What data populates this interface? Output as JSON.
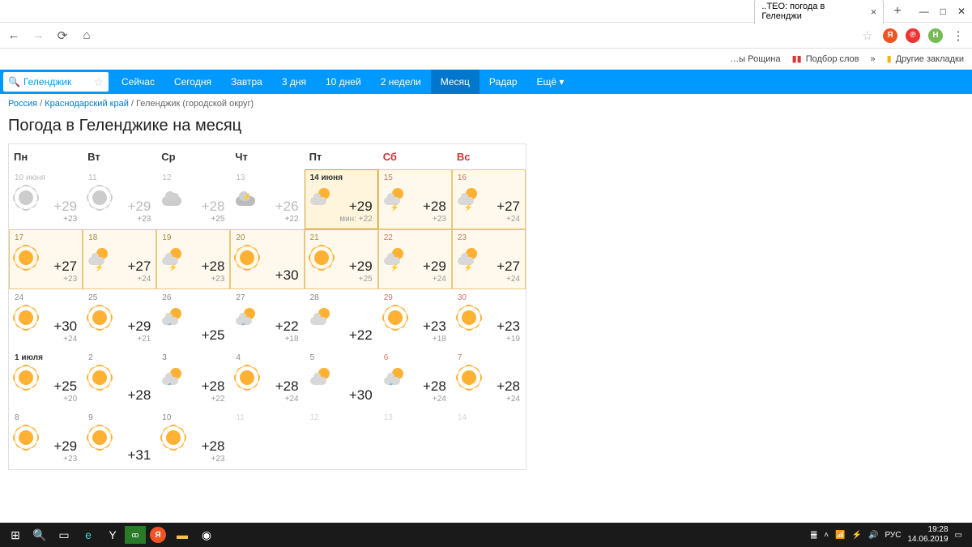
{
  "browser": {
    "tab_title": "..TEO: погода в Геленджи",
    "new_tab": "+",
    "min": "—",
    "max": "□",
    "close": "✕"
  },
  "bookmarks": {
    "b1": "…ы Рощина",
    "b2": "Подбор слов",
    "more": "»",
    "other": "Другие закладки"
  },
  "search": {
    "value": "Геленджик"
  },
  "nav": {
    "now": "Сейчас",
    "today": "Сегодня",
    "tomorrow": "Завтра",
    "d3": "3 дня",
    "d10": "10 дней",
    "w2": "2 недели",
    "month": "Месяц",
    "radar": "Радар",
    "more": "Ещё ▾"
  },
  "crumbs": {
    "c1": "Россия",
    "c2": "Краснодарский край",
    "c3": "Геленджик (городской округ)"
  },
  "title": "Погода в Геленджике на месяц",
  "days": {
    "mo": "Пн",
    "tu": "Вт",
    "we": "Ср",
    "th": "Чт",
    "fr": "Пт",
    "sa": "Сб",
    "su": "Вс"
  },
  "cells": [
    {
      "dt": "10 июня",
      "hi": "+29",
      "lo": "+23",
      "ic": "sund",
      "cls": "past"
    },
    {
      "dt": "11",
      "hi": "+29",
      "lo": "+23",
      "ic": "sund",
      "cls": "past"
    },
    {
      "dt": "12",
      "hi": "+28",
      "lo": "+25",
      "ic": "cloudd",
      "cls": "past"
    },
    {
      "dt": "13",
      "hi": "+26",
      "lo": "+22",
      "ic": "stormd",
      "cls": "past"
    },
    {
      "dt": "14 июня",
      "hi": "+29",
      "lo": "мин: +22",
      "ic": "suncloud",
      "cls": "today"
    },
    {
      "dt": "15",
      "hi": "+28",
      "lo": "+23",
      "ic": "sunstorm",
      "cls": "hl",
      "we": true
    },
    {
      "dt": "16",
      "hi": "+27",
      "lo": "+24",
      "ic": "sunstorm",
      "cls": "hl",
      "we": true
    },
    {
      "dt": "17",
      "hi": "+27",
      "lo": "+23",
      "ic": "sun",
      "cls": "hl"
    },
    {
      "dt": "18",
      "hi": "+27",
      "lo": "+24",
      "ic": "sunstorm",
      "cls": "hl"
    },
    {
      "dt": "19",
      "hi": "+28",
      "lo": "+23",
      "ic": "sunstorm",
      "cls": "hl"
    },
    {
      "dt": "20",
      "hi": "+30",
      "lo": "",
      "ic": "sun",
      "cls": "hl"
    },
    {
      "dt": "21",
      "hi": "+29",
      "lo": "+25",
      "ic": "sun",
      "cls": "hl"
    },
    {
      "dt": "22",
      "hi": "+29",
      "lo": "+24",
      "ic": "sunstorm",
      "cls": "hl",
      "we": true
    },
    {
      "dt": "23",
      "hi": "+27",
      "lo": "+24",
      "ic": "sunstorm",
      "cls": "hl",
      "we": true
    },
    {
      "dt": "24",
      "hi": "+30",
      "lo": "+24",
      "ic": "sun",
      "cls": ""
    },
    {
      "dt": "25",
      "hi": "+29",
      "lo": "+21",
      "ic": "sun",
      "cls": ""
    },
    {
      "dt": "26",
      "hi": "+25",
      "lo": "",
      "ic": "sunrain",
      "cls": ""
    },
    {
      "dt": "27",
      "hi": "+22",
      "lo": "+18",
      "ic": "sunrain",
      "cls": ""
    },
    {
      "dt": "28",
      "hi": "+22",
      "lo": "",
      "ic": "suncloud",
      "cls": ""
    },
    {
      "dt": "29",
      "hi": "+23",
      "lo": "+18",
      "ic": "sun",
      "cls": "",
      "we": true
    },
    {
      "dt": "30",
      "hi": "+23",
      "lo": "+19",
      "ic": "sun",
      "cls": "",
      "we": true
    },
    {
      "dt": "1 июля",
      "hi": "+25",
      "lo": "+20",
      "ic": "sun",
      "cls": "",
      "bold": true
    },
    {
      "dt": "2",
      "hi": "+28",
      "lo": "",
      "ic": "sun",
      "cls": ""
    },
    {
      "dt": "3",
      "hi": "+28",
      "lo": "+22",
      "ic": "sunrain",
      "cls": ""
    },
    {
      "dt": "4",
      "hi": "+28",
      "lo": "+24",
      "ic": "sun",
      "cls": ""
    },
    {
      "dt": "5",
      "hi": "+30",
      "lo": "",
      "ic": "suncloud",
      "cls": ""
    },
    {
      "dt": "6",
      "hi": "+28",
      "lo": "+24",
      "ic": "sunrain",
      "cls": "",
      "we": true
    },
    {
      "dt": "7",
      "hi": "+28",
      "lo": "+24",
      "ic": "sun",
      "cls": "",
      "we": true
    },
    {
      "dt": "8",
      "hi": "+29",
      "lo": "+23",
      "ic": "sun",
      "cls": ""
    },
    {
      "dt": "9",
      "hi": "+31",
      "lo": "",
      "ic": "sun",
      "cls": ""
    },
    {
      "dt": "10",
      "hi": "+28",
      "lo": "+23",
      "ic": "sun",
      "cls": ""
    },
    {
      "dt": "11",
      "hi": "",
      "lo": "",
      "ic": "",
      "cls": "future"
    },
    {
      "dt": "12",
      "hi": "",
      "lo": "",
      "ic": "",
      "cls": "future"
    },
    {
      "dt": "13",
      "hi": "",
      "lo": "",
      "ic": "",
      "cls": "future"
    },
    {
      "dt": "14",
      "hi": "",
      "lo": "",
      "ic": "",
      "cls": "future"
    }
  ],
  "taskbar": {
    "lang": "РУС",
    "time": "19:28",
    "date": "14.06.2019"
  }
}
